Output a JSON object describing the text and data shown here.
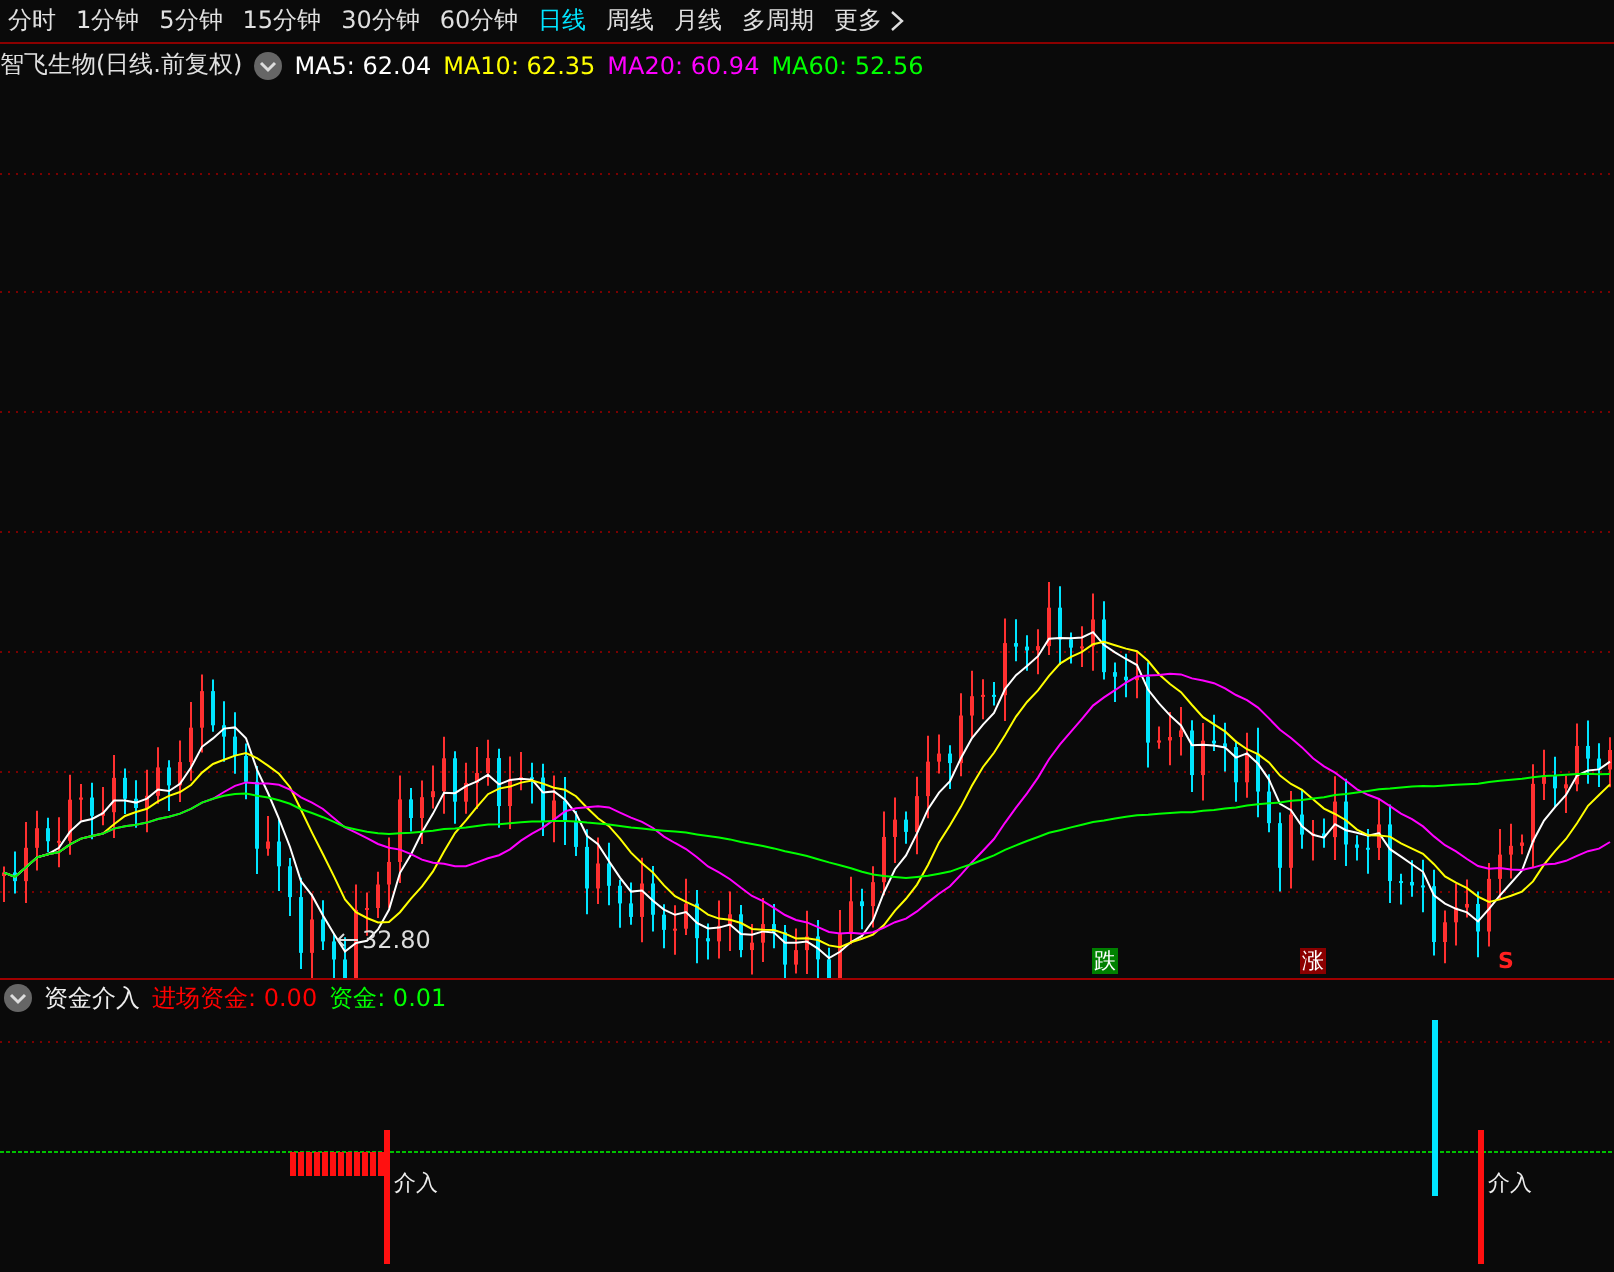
{
  "period_tabs": [
    {
      "label": "分时",
      "selected": false
    },
    {
      "label": "1分钟",
      "selected": false
    },
    {
      "label": "5分钟",
      "selected": false
    },
    {
      "label": "15分钟",
      "selected": false
    },
    {
      "label": "30分钟",
      "selected": false
    },
    {
      "label": "60分钟",
      "selected": false
    },
    {
      "label": "日线",
      "selected": true
    },
    {
      "label": "周线",
      "selected": false
    },
    {
      "label": "月线",
      "selected": false
    },
    {
      "label": "多周期",
      "selected": false
    },
    {
      "label": "更多",
      "selected": false
    }
  ],
  "chart_header": {
    "title": "智飞生物(日线.前复权)",
    "ma_values": [
      {
        "label": "MA5: 62.04",
        "color": "#ffffff"
      },
      {
        "label": "MA10: 62.35",
        "color": "#ffff00"
      },
      {
        "label": "MA20: 60.94",
        "color": "#ff00ff"
      },
      {
        "label": "MA60: 52.56",
        "color": "#00ff00"
      }
    ]
  },
  "main_chart": {
    "low_label": "32.80",
    "signals": [
      {
        "kind": "fall",
        "text": "跌"
      },
      {
        "kind": "rise",
        "text": "涨"
      },
      {
        "kind": "sell",
        "text": "S"
      }
    ]
  },
  "indicator": {
    "name": "资金介入",
    "values": [
      {
        "label": "进场资金: 0.00",
        "color": "#ff0000"
      },
      {
        "label": "资金: 0.01",
        "color": "#00ff00"
      }
    ],
    "markers": [
      {
        "text": "介入"
      },
      {
        "text": "介入"
      }
    ]
  }
}
